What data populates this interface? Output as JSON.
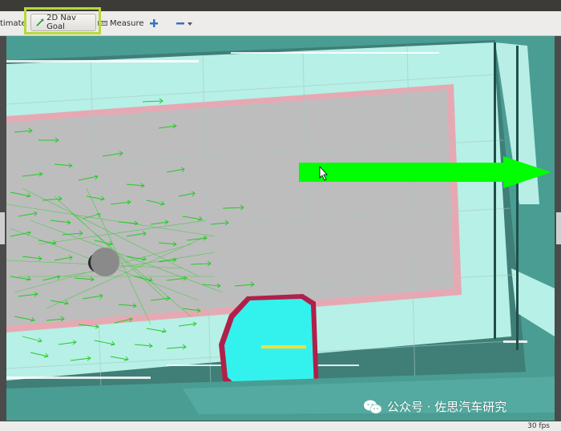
{
  "toolbar": {
    "estimate_label": "timate",
    "nav_goal_label": "2D Nav Goal",
    "measure_label": "Measure"
  },
  "statusbar": {
    "fps": "30 fps"
  },
  "watermark": {
    "text": "公众号 · 佐思汽车研究"
  },
  "colors": {
    "floor": "#4a9d93",
    "free_space": "#b7f0e6",
    "costmap": "#bdbdbd",
    "inflation": "#e6a9b3",
    "particles": "#22cc22",
    "goal_arrow": "#00ff00",
    "obstacle_cyan": "#33f2ee",
    "obstacle_border": "#b0204a",
    "highlight": "#b8d83a"
  }
}
